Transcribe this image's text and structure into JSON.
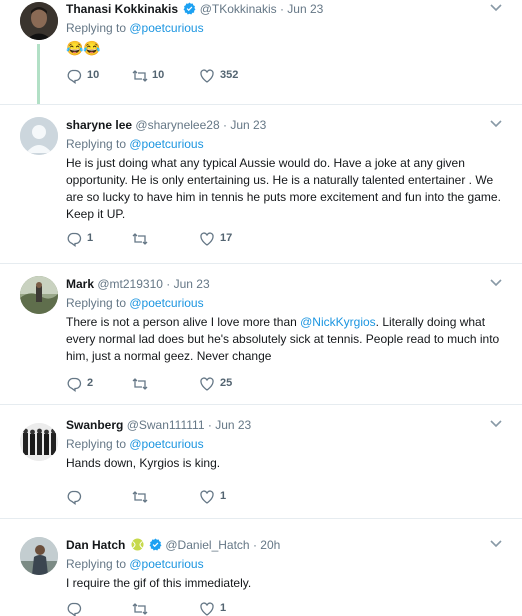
{
  "tweets": [
    {
      "name": "Thanasi Kokkinakis",
      "handle": "@TKokkinakis",
      "dot": "·",
      "time": "Jun 23",
      "replying_prefix": "Replying to ",
      "replying_to": "@poetcurious",
      "text": "😂😂",
      "replies": "10",
      "retweets": "10",
      "likes": "352",
      "verified": true
    },
    {
      "name": "sharyne lee",
      "handle": "@sharynelee28",
      "dot": "·",
      "time": "Jun 23",
      "replying_prefix": "Replying to ",
      "replying_to": "@poetcurious",
      "text": "He is just doing what any typical Aussie would do. Have a joke at any given opportunity. He is only entertaining us. He is a naturally talented entertainer . We are so lucky to have him in tennis he puts more excitement and fun into the game. Keep it UP.",
      "replies": "1",
      "retweets": "",
      "likes": "17"
    },
    {
      "name": "Mark",
      "handle": "@mt219310",
      "dot": "·",
      "time": "Jun 23",
      "replying_prefix": "Replying to ",
      "replying_to": "@poetcurious",
      "text_before": "There is not a person alive I love more than ",
      "mention": "@NickKyrgios",
      "text_after": ". Literally doing what every normal lad does but he's absolutely sick at tennis. People read to much into him, just a normal geez. Never change",
      "replies": "2",
      "retweets": "",
      "likes": "25"
    },
    {
      "name": "Swanberg",
      "handle": "@Swan111111",
      "dot": "·",
      "time": "Jun 23",
      "replying_prefix": "Replying to ",
      "replying_to": "@poetcurious",
      "text": "Hands down, Kyrgios is king.",
      "replies": "",
      "retweets": "",
      "likes": "1"
    },
    {
      "name": "Dan Hatch",
      "handle": "@Daniel_Hatch",
      "dot": "·",
      "time": "20h",
      "replying_prefix": "Replying to ",
      "replying_to": "@poetcurious",
      "text": "I require the gif of this immediately.",
      "replies": "",
      "retweets": "",
      "likes": "1",
      "verified": true
    }
  ],
  "icons": {
    "reply": "reply-icon",
    "retweet": "retweet-icon",
    "like": "heart-icon",
    "more": "chevron-down-icon",
    "verified": "verified-badge-icon",
    "tennis": "tennis-ball-icon"
  },
  "colors": {
    "accent": "#1b95e0",
    "muted": "#657786",
    "thread": "#b2e0c6",
    "verified": "#1da1f2"
  }
}
